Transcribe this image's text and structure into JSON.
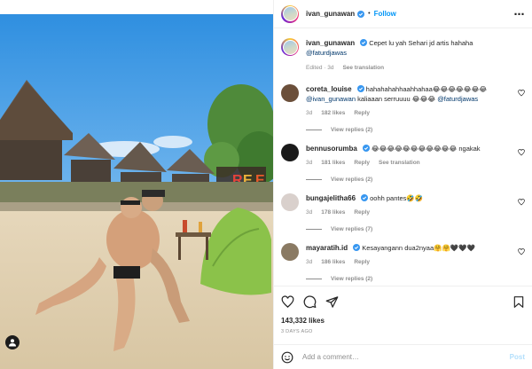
{
  "post": {
    "author": "ivan_gunawan",
    "follow_label": "Follow",
    "dot": "•",
    "more_icon": "⋯",
    "caption_prefix": "Cepet lu yah Sehari jd artis hahaha",
    "caption_mention": "@faturdjawas",
    "edited": "Edited · 3d",
    "see_translation": "See translation",
    "likes": "143,332 likes",
    "date": "3 DAYS AGO"
  },
  "comments": [
    {
      "user": "coreta_louise",
      "verified": true,
      "text_a": "hahahahahhaahhahaa😂😂😂😂😂😂😂",
      "mention_a": "@ivan_gunawan",
      "text_b": "kaliaaan serruuuu 😂😂😂",
      "mention_b": "@faturdjawas",
      "time": "3d",
      "likes": "182 likes",
      "reply": "Reply",
      "see_translation": "",
      "replies": "View replies (2)",
      "avatar_color": "#6b4f3a"
    },
    {
      "user": "bennusorumba",
      "verified": true,
      "text_a": "😂😂😂😂😂😂😂😂😂😂😂 ngakak",
      "time": "3d",
      "likes": "181 likes",
      "reply": "Reply",
      "see_translation": "See translation",
      "replies": "View replies (2)",
      "avatar_color": "#1a1a1a"
    },
    {
      "user": "bungajelitha66",
      "verified": true,
      "text_a": "oohh pantes🤣🤣",
      "time": "3d",
      "likes": "178 likes",
      "reply": "Reply",
      "see_translation": "",
      "replies": "View replies (7)",
      "avatar_color": "#d9d0cc"
    },
    {
      "user": "mayaratih.id",
      "verified": true,
      "text_a": "Kesayangann dua2nyaa🤗🤗🖤🖤🖤",
      "time": "3d",
      "likes": "186 likes",
      "reply": "Reply",
      "see_translation": "",
      "replies": "View replies (2)",
      "avatar_color": "#8a7a63"
    }
  ],
  "composer": {
    "placeholder": "Add a comment…",
    "post_label": "Post"
  },
  "icons": {
    "like": "heart-icon",
    "comment": "comment-icon",
    "share": "send-icon",
    "save": "bookmark-icon",
    "emoji": "smiley-icon",
    "tag": "user-tag-icon",
    "verified": "verified-badge-icon"
  },
  "colors": {
    "accent": "#0095f6",
    "post_disabled": "#b2dffc",
    "muted": "#8e8e8e",
    "mention": "#00376b"
  }
}
